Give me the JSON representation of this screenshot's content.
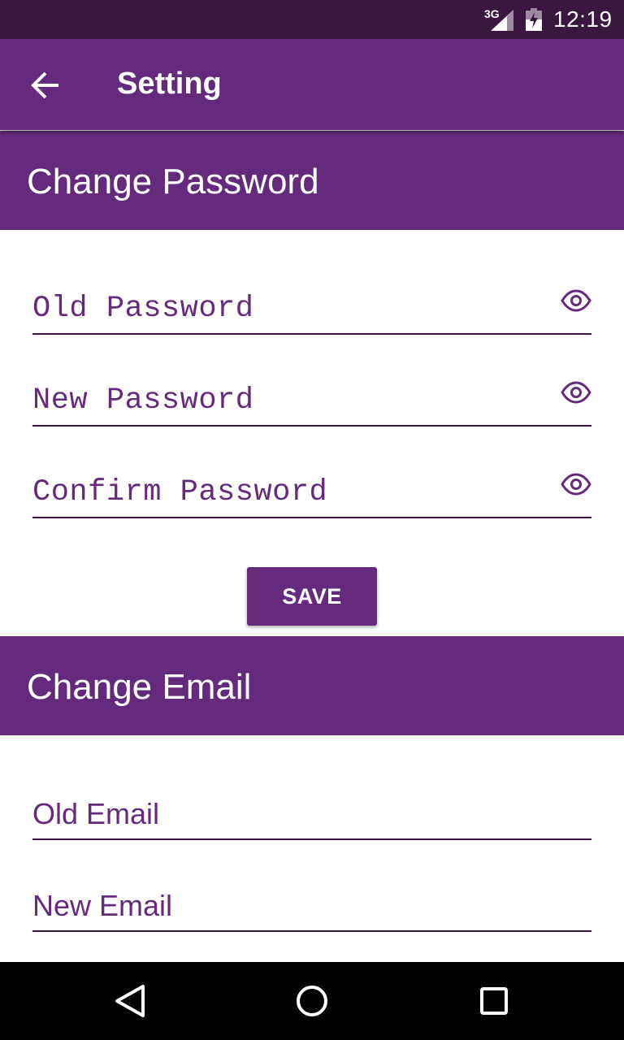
{
  "status_bar": {
    "network": "3G",
    "time": "12:19"
  },
  "app_bar": {
    "title": "Setting"
  },
  "password_section": {
    "title": "Change Password",
    "fields": [
      {
        "placeholder": "Old Password",
        "value": ""
      },
      {
        "placeholder": "New Password",
        "value": ""
      },
      {
        "placeholder": "Confirm Password",
        "value": ""
      }
    ],
    "save_label": "SAVE"
  },
  "email_section": {
    "title": "Change Email",
    "fields": [
      {
        "placeholder": "Old Email",
        "value": ""
      },
      {
        "placeholder": "New Email",
        "value": ""
      }
    ]
  },
  "colors": {
    "primary": "#662a7c",
    "status_bar": "#3b1641",
    "underline": "#3b1641",
    "nav_bar": "#000000"
  },
  "icons": {
    "back": "arrow-back-icon",
    "visibility": "eye-icon",
    "nav_back": "triangle-back-icon",
    "nav_home": "circle-home-icon",
    "nav_recent": "square-recents-icon"
  }
}
